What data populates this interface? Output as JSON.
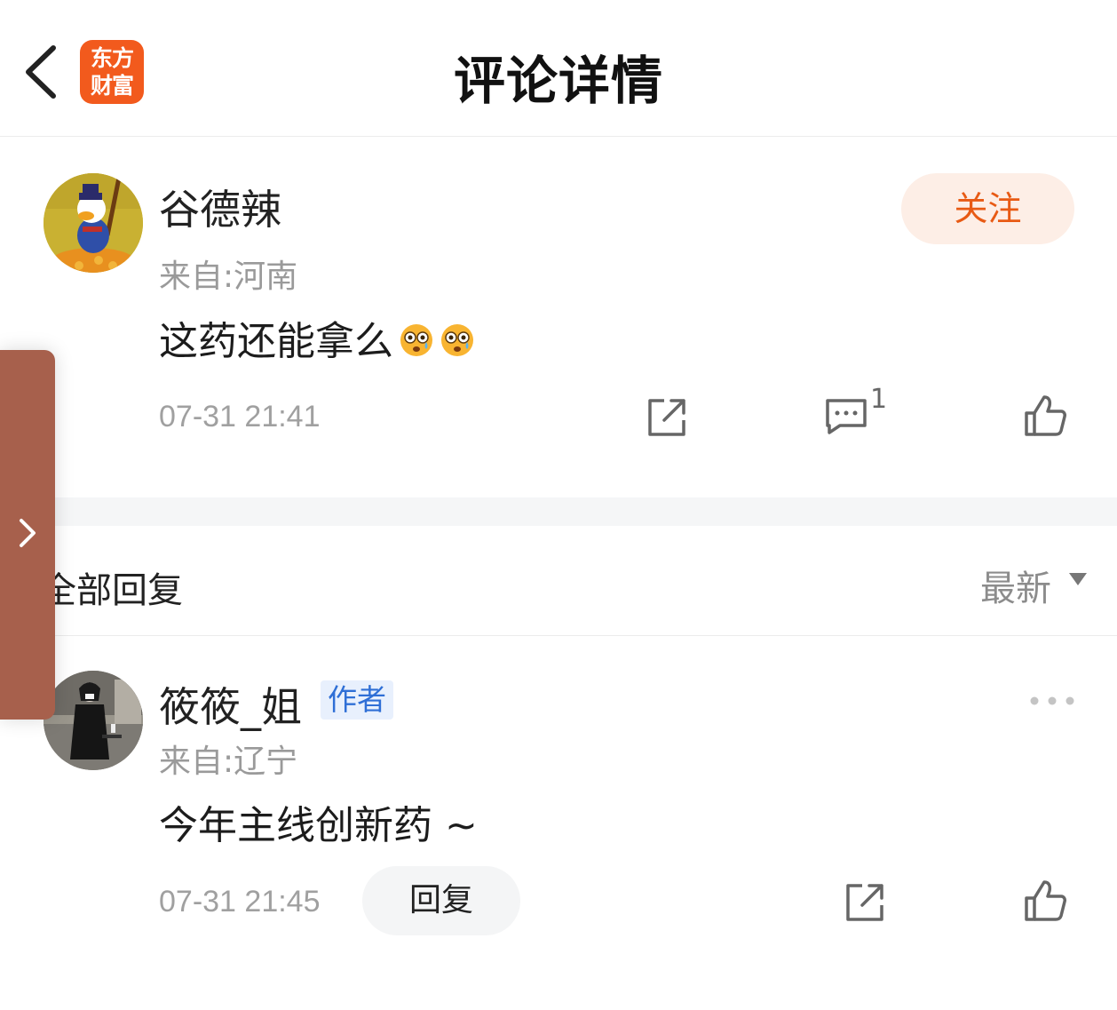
{
  "header": {
    "title": "评论详情",
    "logo_line1": "东方",
    "logo_line2": "财富",
    "logo_color": "#f25a1d"
  },
  "main_comment": {
    "username": "谷德辣",
    "location": "来自:河南",
    "content": "这药还能拿么",
    "emojis": [
      "flushed-face-tears",
      "flushed-face-tears"
    ],
    "time": "07-31 21:41",
    "follow_label": "关注",
    "reply_count": "1"
  },
  "replies_section": {
    "title": "全部回复",
    "sort_label": "最新"
  },
  "replies": [
    {
      "username": "筱筱_姐",
      "badge": "作者",
      "location": "来自:辽宁",
      "content": "今年主线创新药 ~",
      "time": "07-31 21:45",
      "reply_label": "回复"
    }
  ],
  "colors": {
    "accent": "#e85a14",
    "badge_blue": "#2f6fd6",
    "side_tab": "#a7604c"
  }
}
